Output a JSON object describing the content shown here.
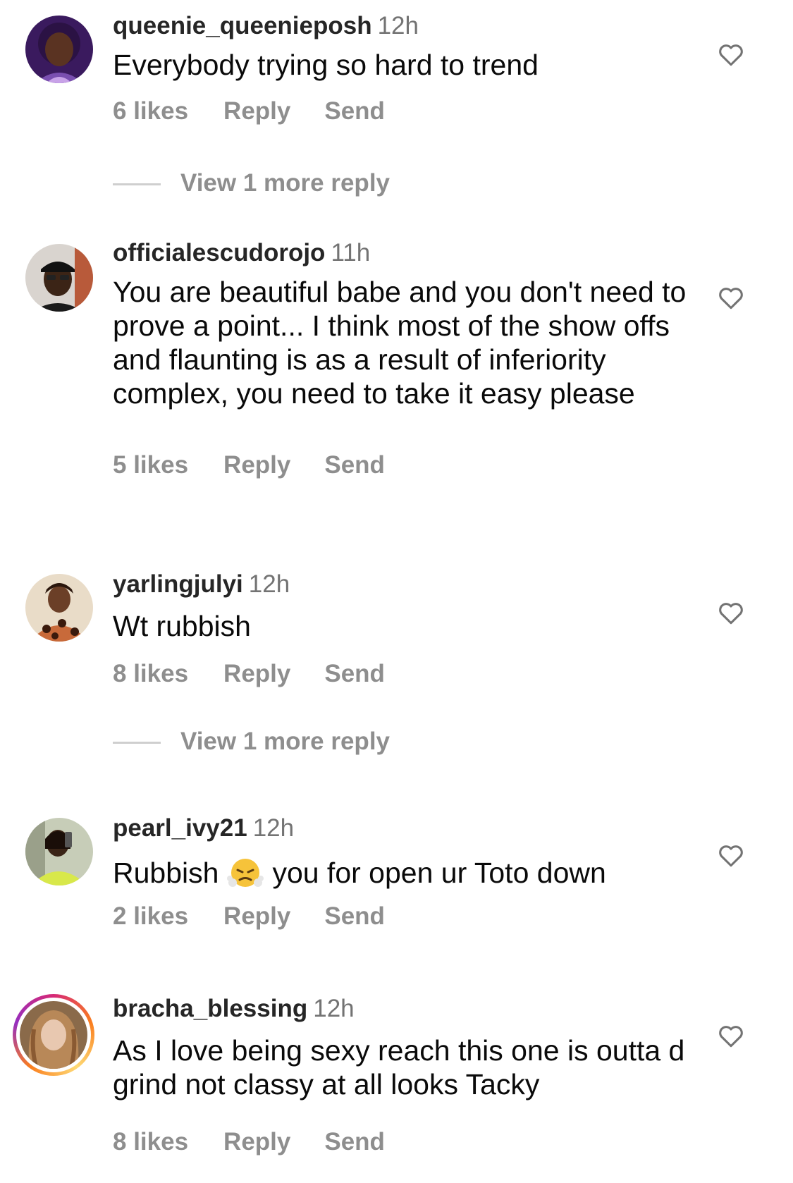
{
  "comments": [
    {
      "username": "queenie_queenieposh",
      "time": "12h",
      "text": "Everybody trying so hard to trend",
      "likes": "6 likes",
      "reply": "Reply",
      "send": "Send",
      "view_more": "View 1 more reply"
    },
    {
      "username": "officialescudorojo",
      "time": "11h",
      "text": "You are beautiful babe and you don't need to prove a point... I think most of the show offs and flaunting is as a result of inferiority complex, you need to take it easy please",
      "likes": "5 likes",
      "reply": "Reply",
      "send": "Send"
    },
    {
      "username": "yarlingjulyi",
      "time": "12h",
      "text": "Wt rubbish",
      "likes": "8 likes",
      "reply": "Reply",
      "send": "Send",
      "view_more": "View 1 more reply"
    },
    {
      "username": "pearl_ivy21",
      "time": "12h",
      "text_before": "Rubbish",
      "emoji": "face-with-steam-icon",
      "text_after": "you for open ur Toto down",
      "likes": "2 likes",
      "reply": "Reply",
      "send": "Send"
    },
    {
      "username": "bracha_blessing",
      "time": "12h",
      "text": "As I love being sexy reach this one is outta d grind not classy at all looks Tacky",
      "likes": "8 likes",
      "reply": "Reply",
      "send": "Send"
    }
  ],
  "colors": {
    "username": "#262626",
    "secondary": "#8e8e8e",
    "story_ring": "#d62976"
  }
}
